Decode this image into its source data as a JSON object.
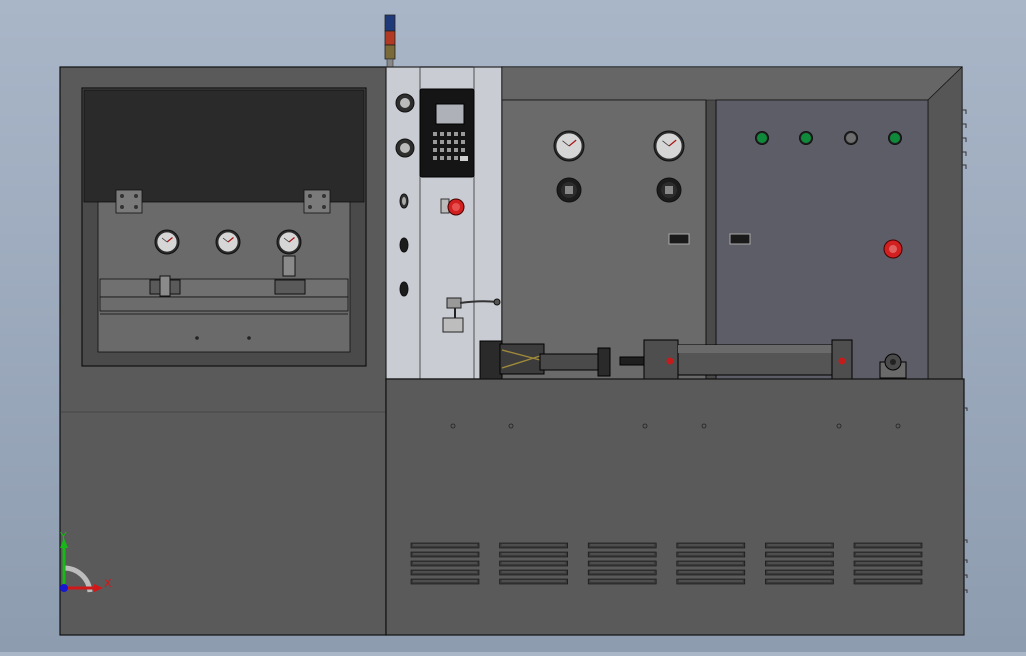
{
  "viewport": {
    "background_top": "#a9b6c8",
    "background_bottom": "#8e9cb0"
  },
  "model": {
    "panel_color": "#5a5a5a",
    "panel_dark": "#4a4a4a",
    "window_dark": "#2a2a2a",
    "inner_panel": "#6a6a6a",
    "steel_light": "#c9ccd2",
    "cabinet_right": "#5c5d66",
    "indicator_green": "#0f8a3a",
    "indicator_gray": "#6e6e6e",
    "estop_red": "#d21f1f",
    "tower_light_colors": [
      "#1e3a78",
      "#b23a24",
      "#7a6a3a"
    ]
  },
  "left_gauges": {
    "count": 3
  },
  "upper_gauges": {
    "count": 2
  },
  "indicator_lights": {
    "states": [
      "green",
      "green",
      "gray",
      "green"
    ]
  },
  "vent_groups": {
    "count": 6,
    "slots_per_group": 5
  },
  "triad": {
    "x_label": "X",
    "y_label": "Y",
    "x_color": "#d01818",
    "y_color": "#18b818",
    "z_color": "#1818d0"
  }
}
